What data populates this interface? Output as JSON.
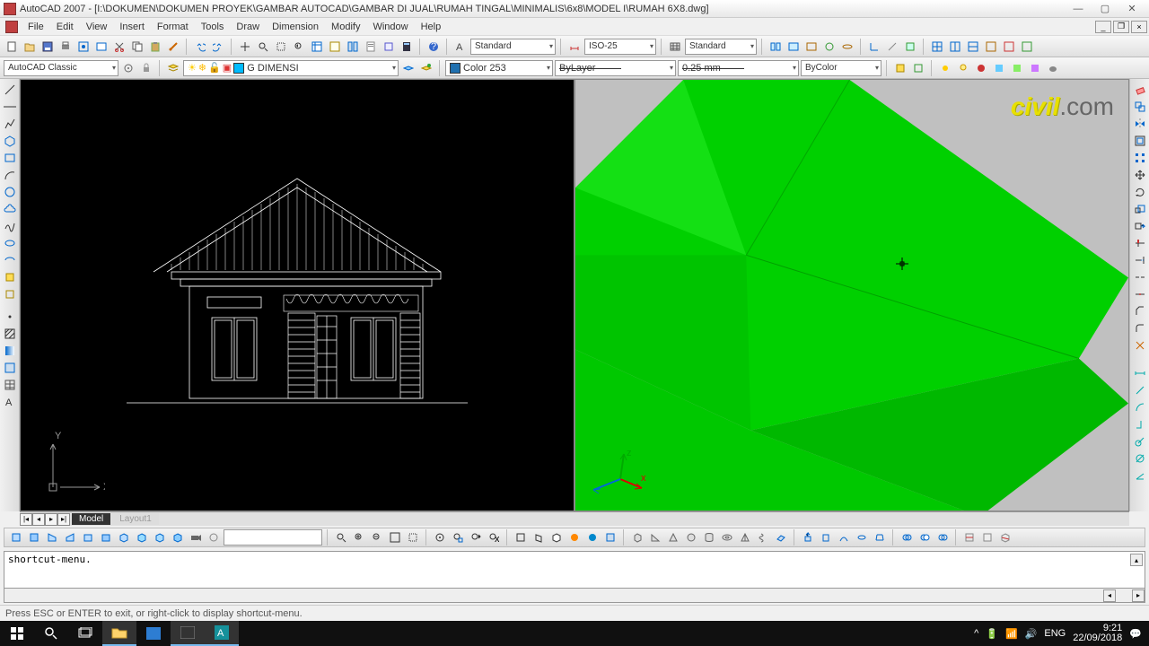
{
  "titlebar": {
    "title": "AutoCAD 2007 - [I:\\DOKUMEN\\DOKUMEN PROYEK\\GAMBAR AUTOCAD\\GAMBAR DI JUAL\\RUMAH TINGAL\\MINIMALIS\\6x8\\MODEL I\\RUMAH 6X8.dwg]",
    "min": "—",
    "max": "▢",
    "close": "✕"
  },
  "menu": [
    "File",
    "Edit",
    "View",
    "Insert",
    "Format",
    "Tools",
    "Draw",
    "Dimension",
    "Modify",
    "Window",
    "Help"
  ],
  "row1": {
    "workspace": "AutoCAD Classic",
    "text_style": "Standard",
    "dim_style": "ISO-25",
    "table_style": "Standard"
  },
  "row2": {
    "layer": "G DIMENSI",
    "color": "Color 253",
    "linetype": "ByLayer",
    "lineweight": "0.25 mm",
    "plotstyle": "ByColor"
  },
  "tabs": {
    "model": "Model",
    "layout": "Layout1"
  },
  "cmd": {
    "line1": "shortcut-menu.",
    "line2": ""
  },
  "status": "Press ESC or ENTER to exit, or right-click to display shortcut-menu.",
  "watermark": {
    "brand": "civil",
    "suffix": ".com"
  },
  "tray": {
    "lang": "ENG",
    "time": "9:21",
    "date": "22/09/2018"
  },
  "ucs2d": {
    "x": "X",
    "y": "Y"
  }
}
